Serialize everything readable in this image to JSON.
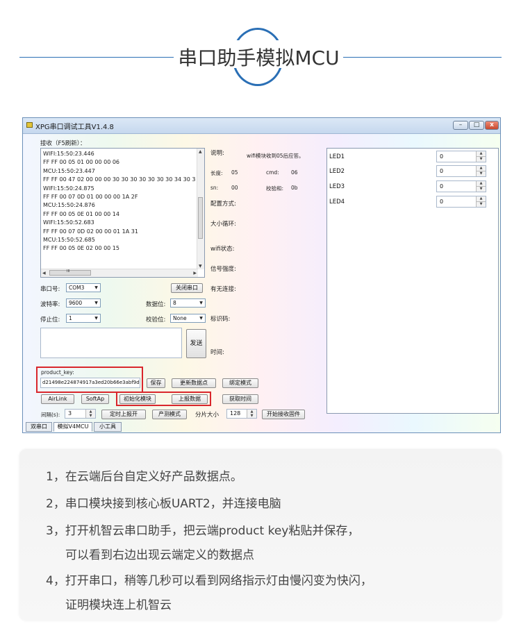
{
  "header": {
    "title": "串口助手模拟MCU"
  },
  "window": {
    "title": "XPG串口调试工具V1.4.8",
    "controls": {
      "minimize": "–",
      "maximize": "□",
      "close": "x"
    },
    "receive_label": "接收（F5刷新）：",
    "receive_lines": [
      "WIFI:15:50:23.446",
      "FF FF 00 05 01 00 00 00 06",
      "MCU:15:50:23.447",
      "FF FF 00 47 02 00 00 00 30 30 30 30 30 30 30 34 30 3",
      "WIFI:15:50:24.875",
      "FF FF 00 07 0D 01 00 00 00 1A 2F",
      "MCU:15:50:24.876",
      "FF FF 00 05 0E 01 00 00 14",
      "WIFI:15:50:52.683",
      "FF FF 00 07 0D 02 00 00 01 1A 31",
      "MCU:15:50:52.685",
      "FF FF 00 05 0E 02 00 00 15"
    ],
    "hscroll_mid": "III",
    "serial": {
      "port_label": "串口号:",
      "port_value": "COM3",
      "close_port_button": "关闭串口",
      "baud_label": "波特率:",
      "baud_value": "9600",
      "databits_label": "数据位:",
      "databits_value": "8",
      "stopbits_label": "停止位:",
      "stopbits_value": "1",
      "parity_label": "校验位:",
      "parity_value": "None"
    },
    "send_button": "发送",
    "product_key_label": "product_key:",
    "product_key_value": "d21498e224874917a3ed20b66e3abf9d",
    "buttons": {
      "save": "保存",
      "update_points": "更新数据点",
      "bind_mode": "绑定模式",
      "airlink": "AirLink",
      "softap": "SoftAp",
      "init_module": "初始化模块",
      "report_data": "上报数据",
      "get_time": "获取时间",
      "timed_report": "定时上报开",
      "production_mode": "产测模式",
      "start_receive_fw": "开始接收固件"
    },
    "interval_label": "间隔(s):",
    "interval_value": "3",
    "packet_size_label": "分片大小",
    "packet_size_value": "128",
    "info": {
      "desc_label": "说明:",
      "desc_value": "wifi模块收到05后应答。",
      "length_label": "长度:",
      "length_value": "05",
      "cmd_label": "cmd:",
      "cmd_value": "06",
      "sn_label": "sn:",
      "sn_value": "00",
      "checksum_label": "校验和:",
      "checksum_value": "0b",
      "config_label": "配置方式:",
      "loop_label": "大小循环:",
      "wifi_status_label": "wifi状态:",
      "signal_label": "信号强度:",
      "connected_label": "有无连接:",
      "id_code_label": "标识码:",
      "time_label": "时间:"
    },
    "leds": [
      {
        "label": "LED1",
        "value": "0"
      },
      {
        "label": "LED2",
        "value": "0"
      },
      {
        "label": "LED3",
        "value": "0"
      },
      {
        "label": "LED4",
        "value": "0"
      }
    ],
    "tabs": [
      "双串口",
      "模拟V4MCU",
      "小工具"
    ]
  },
  "instructions": [
    "1，在云端后台自定义好产品数据点。",
    "2，串口模块接到核心板UART2，并连接电脑",
    "3，打开机智云串口助手，把云端product key粘贴并保存，",
    "可以看到右边出现云端定义的数据点",
    "4，打开串口，稍等几秒可以看到网络指示灯由慢闪变为快闪，",
    "证明模块连上机智云"
  ],
  "colors": {
    "accent": "#2a6fb5",
    "highlight_box": "#d9262c"
  }
}
